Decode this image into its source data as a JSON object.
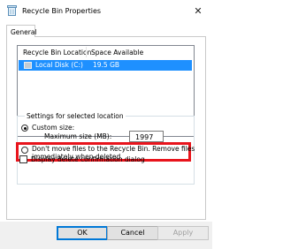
{
  "window": {
    "title": "Recycle Bin Properties",
    "close_symbol": "✕"
  },
  "tabs": [
    {
      "label": "General"
    }
  ],
  "location_list": {
    "headers": [
      "Recycle Bin Location",
      "Space Available"
    ],
    "rows": [
      {
        "location": "Local Disk (C:)",
        "space": "19.5 GB",
        "selected": true
      }
    ]
  },
  "settings": {
    "group_title": "Settings for selected location",
    "custom_size_label": "Custom size:",
    "custom_size_selected": true,
    "max_size_label": "Maximum size (MB):",
    "max_size_value": "1997",
    "no_move_label_line1": "Don't move files to the Recycle Bin. Remove files",
    "no_move_label_line2": "immediately when deleted.",
    "no_move_selected": false
  },
  "confirm_dialog": {
    "label": "Display delete confirmation dialog",
    "checked": false
  },
  "buttons": {
    "ok": "OK",
    "cancel": "Cancel",
    "apply": "Apply"
  },
  "colors": {
    "selection": "#1e90ff",
    "highlight_box": "#e8141c",
    "default_button_border": "#0078d7"
  }
}
